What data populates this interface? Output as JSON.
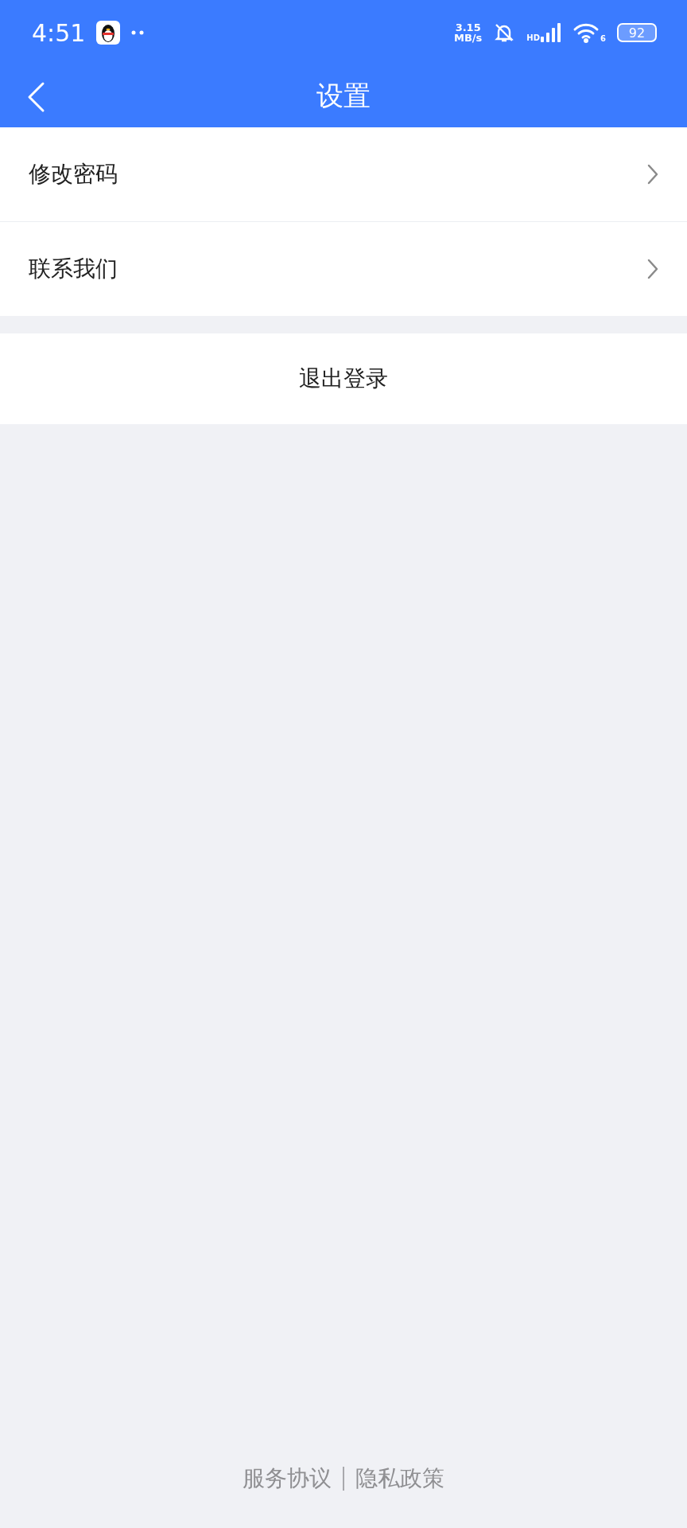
{
  "status_bar": {
    "time": "4:51",
    "speed_value": "3.15",
    "speed_unit": "MB/s",
    "signal_label": "HD",
    "wifi_label": "6",
    "battery": "92"
  },
  "nav": {
    "title": "设置"
  },
  "menu_items": [
    {
      "label": "修改密码"
    },
    {
      "label": "联系我们"
    }
  ],
  "logout_button": "退出登录",
  "footer_links": [
    "服务协议",
    "隐私政策"
  ]
}
